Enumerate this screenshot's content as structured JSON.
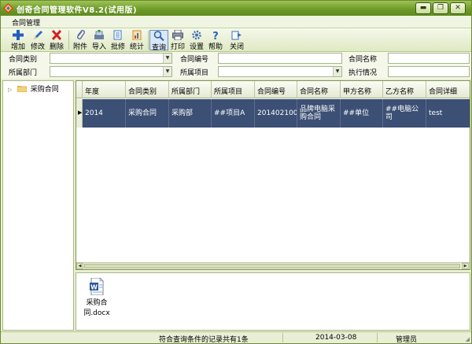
{
  "window": {
    "title": "创奇合同管理软件V8.2(试用版)",
    "controls": {
      "minimize": "▬",
      "restore": "❐",
      "close": "✕"
    }
  },
  "menu": {
    "items": [
      "合同管理"
    ]
  },
  "toolbar": {
    "buttons": [
      {
        "label": "增加",
        "icon": "add-icon",
        "color": "#1f5fbf"
      },
      {
        "label": "修改",
        "icon": "edit-icon",
        "color": "#2b6cc9"
      },
      {
        "label": "删除",
        "icon": "delete-icon",
        "color": "#d22020"
      },
      {
        "label": "附件",
        "icon": "paperclip-icon",
        "color": "#5a6ea8"
      },
      {
        "label": "导入",
        "icon": "import-icon",
        "color": "#4a6a9a"
      },
      {
        "label": "批修",
        "icon": "batch-edit-icon",
        "color": "#3b76c4"
      },
      {
        "label": "统计",
        "icon": "statistics-icon",
        "color": "#d08a20"
      },
      {
        "label": "查询",
        "icon": "search-icon",
        "color": "#2f5f9e"
      },
      {
        "label": "打印",
        "icon": "print-icon",
        "color": "#505a6a"
      },
      {
        "label": "设置",
        "icon": "settings-icon",
        "color": "#3f6fb0"
      },
      {
        "label": "帮助",
        "icon": "help-icon",
        "color": "#2a62c0"
      },
      {
        "label": "关闭",
        "icon": "close-window-icon",
        "color": "#2f6fbf"
      }
    ]
  },
  "filters": {
    "contract_type_label": "合同类别",
    "contract_type_value": "",
    "contract_no_label": "合同编号",
    "contract_no_value": "",
    "contract_name_label": "合同名称",
    "contract_name_value": "",
    "department_label": "所属部门",
    "department_value": "",
    "project_label": "所属项目",
    "project_value": "",
    "execution_label": "执行情况",
    "execution_value": ""
  },
  "tree": {
    "nodes": [
      {
        "label": "采购合同",
        "expander": "▷"
      }
    ]
  },
  "grid": {
    "columns": [
      "年度",
      "合同类别",
      "所属部门",
      "所属项目",
      "合同编号",
      "合同名称",
      "甲方名称",
      "乙方名称",
      "合同详细"
    ],
    "rows": [
      [
        "2014",
        "采购合同",
        "采购部",
        "##项目A",
        "201402100",
        "品牌电脑采购合同",
        "##单位",
        "##电脑公司",
        "test"
      ]
    ],
    "selected_row_color": "#3c4f74"
  },
  "attachments": {
    "files": [
      {
        "name": "采购合同.docx",
        "icon": "word-document-icon"
      }
    ]
  },
  "status": {
    "record_text": "符合查询条件的记录共有1条",
    "date": "2014-03-08",
    "user": "管理员"
  }
}
